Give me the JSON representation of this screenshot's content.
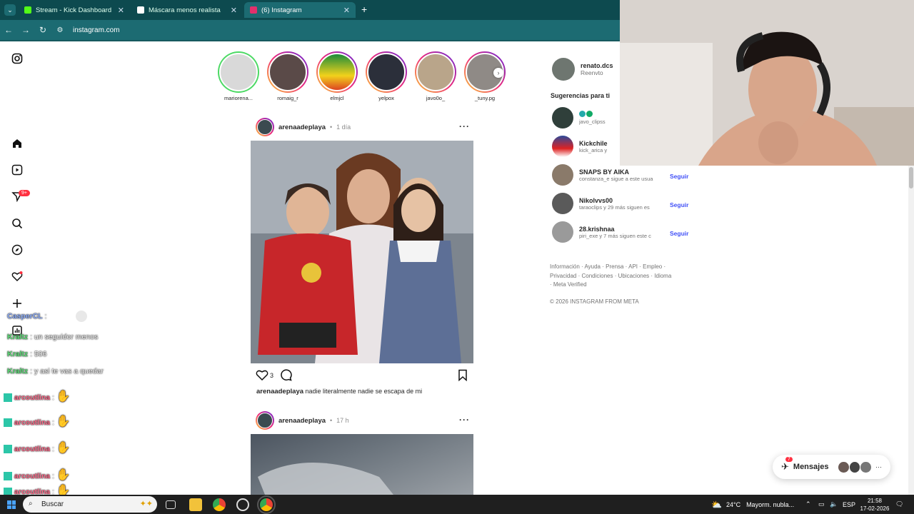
{
  "browser": {
    "tabs": [
      {
        "title": "Stream - Kick Dashboard",
        "fav_color": "#53fc18"
      },
      {
        "title": "Máscara menos realista",
        "fav_color": "#ffffff"
      },
      {
        "title": "(6) Instagram",
        "fav_color": "#e1306c"
      }
    ],
    "url": "instagram.com"
  },
  "sidebar": {
    "icons": [
      "instagram-logo-icon",
      "home-icon",
      "reels-icon",
      "messenger-icon",
      "search-icon",
      "explore-icon",
      "notifications-icon",
      "create-icon",
      "dashboard-icon"
    ],
    "messages_badge": "9+"
  },
  "stories": [
    {
      "name": "mariorena..."
    },
    {
      "name": "romaig_r"
    },
    {
      "name": "elmjcl"
    },
    {
      "name": "yelpox"
    },
    {
      "name": "javo0o_"
    },
    {
      "name": "_tuny.pg"
    }
  ],
  "posts": [
    {
      "user": "arenaadeplaya",
      "time": "1 día",
      "likes": "3",
      "caption": "nadie literalmente nadie se escapa de mi"
    },
    {
      "user": "arenaadeplaya",
      "time": "17 h"
    }
  ],
  "profile": {
    "user": "renato.dcs",
    "name": "Reenvto"
  },
  "suggestions": {
    "title": "Sugerencias para ti",
    "items": [
      {
        "name": "",
        "sub": "javo_clipss"
      },
      {
        "name": "Kickchile",
        "sub": "kick_arica y"
      },
      {
        "name": "SNAPS BY AIKA",
        "sub": "constanza_e sigue a este usua",
        "follow": "Seguir"
      },
      {
        "name": "Nikolvvs00",
        "sub": "taraoclips y 29 más siguen es",
        "follow": "Seguir"
      },
      {
        "name": "28.krishnaa",
        "sub": "piri_exe y 7 más siguen este c",
        "follow": "Seguir"
      }
    ]
  },
  "footer": {
    "links": "Información · Ayuda · Prensa · API · Empleo · Privacidad · Condiciones · Ubicaciones · Idioma · Meta Verified",
    "copyright": "© 2026 INSTAGRAM FROM META"
  },
  "chat": [
    {
      "user": "CasperCL",
      "text": ""
    },
    {
      "user": "Kraltz",
      "text": "un seguidor menos"
    },
    {
      "user": "Kraltz",
      "text": "506"
    },
    {
      "user": "Kraltz",
      "text": "y asi te vas a quedar"
    },
    {
      "user": "arcoutlina",
      "text": ""
    },
    {
      "user": "arcoutlina",
      "text": ""
    },
    {
      "user": "arcoutlina",
      "text": ""
    },
    {
      "user": "arcoutlina",
      "text": ""
    },
    {
      "user": "arcoutlina",
      "text": ""
    }
  ],
  "messages": {
    "label": "Mensajes",
    "badge": "7"
  },
  "taskbar": {
    "search": "Buscar",
    "weather": "24°C",
    "weather_text": "Mayorm. nubla...",
    "lang": "ESP",
    "time": "21:58",
    "date": "17-02-2026"
  }
}
